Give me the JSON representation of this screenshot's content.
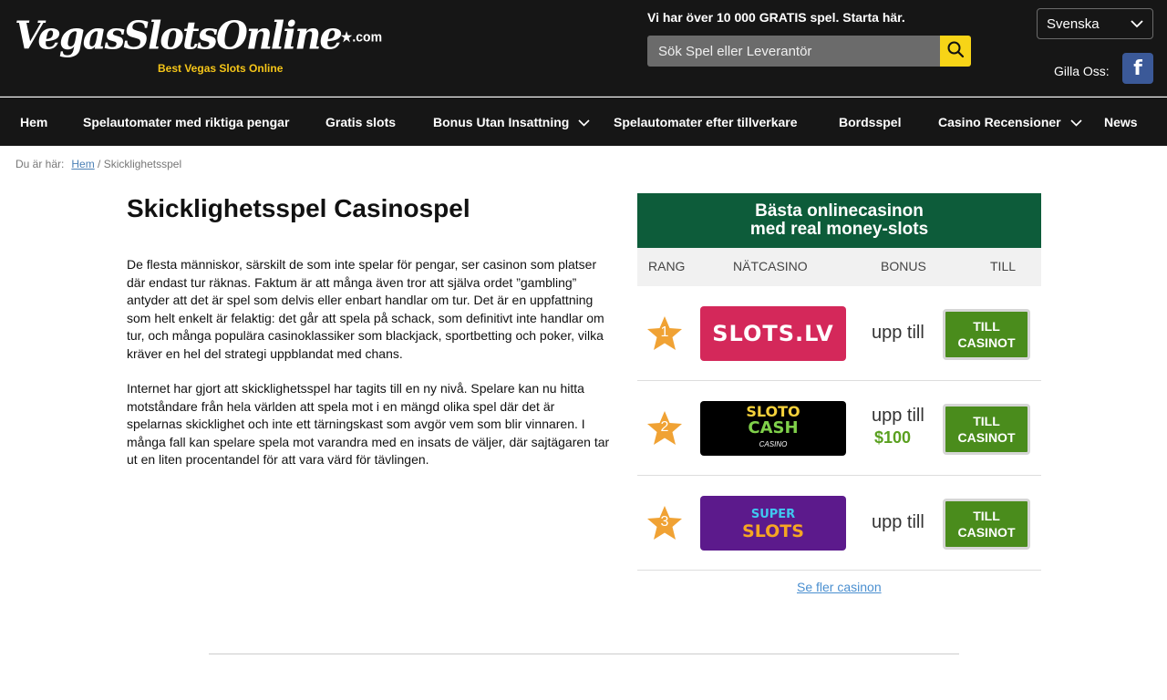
{
  "header": {
    "logo_main": "VegasSlotsOnline",
    "logo_com": "★.com",
    "logo_tagline": "Best Vegas Slots Online",
    "promo": "Vi har över 10 000 GRATIS spel. Starta här.",
    "search_placeholder": "Sök Spel eller Leverantör",
    "language": "Svenska",
    "like_label": "Gilla Oss:",
    "fb_letter": "f"
  },
  "nav": {
    "items": [
      {
        "label": "Hem"
      },
      {
        "label": "Spelautomater med riktiga pengar"
      },
      {
        "label": "Gratis slots"
      },
      {
        "label": "Bonus Utan Insattning"
      },
      {
        "label": "Spelautomater efter tillverkare"
      },
      {
        "label": "Bordsspel"
      },
      {
        "label": "Casino Recensioner"
      },
      {
        "label": "News"
      }
    ]
  },
  "breadcrumb": {
    "prefix": "Du är här:",
    "home": "Hem",
    "separator": "/",
    "current": "Skicklighetsspel"
  },
  "article": {
    "title": "Skicklighetsspel Casinospel",
    "paragraphs": [
      "De flesta människor, särskilt de som inte spelar för pengar, ser casinon som platser där endast tur räknas. Faktum är att många även tror att själva ordet ”gambling” antyder att det är spel som delvis eller enbart handlar om tur. Det är en uppfattning som helt enkelt är felaktig: det går att spela på schack, som definitivt inte handlar om tur, och många populära casinoklassiker som blackjack, sportbetting och poker, vilka kräver en hel del strategi uppblandat med chans.",
      "Internet har gjort att skicklighetsspel har tagits till en ny nivå. Spelare kan nu hitta motståndare från hela världen att spela mot i en mängd olika spel där det är spelarnas skicklighet och inte ett tärningskast som avgör vem som blir vinnaren. I många fall kan spelare spela mot varandra med en insats de väljer, där sajtägaren tar ut en liten procentandel för att vara värd för tävlingen."
    ]
  },
  "casino_panel": {
    "title_line1": "Bästa onlinecasinon",
    "title_line2": "med real money-slots",
    "columns": {
      "rank": "RANG",
      "casino": "NÄTCASINO",
      "bonus": "BONUS",
      "to": "TILL"
    },
    "rows": [
      {
        "rank": "1",
        "logo_text": "SLOTS.LV",
        "bonus_prefix": "upp till",
        "bonus_amount": "",
        "cta_line1": "TILL",
        "cta_line2": "CASINOT"
      },
      {
        "rank": "2",
        "logo_text_top": "SLOTO",
        "logo_text_mid": "CASH",
        "logo_text_bottom": "CASINO",
        "bonus_prefix": "upp till",
        "bonus_amount": "$100",
        "cta_line1": "TILL",
        "cta_line2": "CASINOT"
      },
      {
        "rank": "3",
        "logo_text_top": "SUPER",
        "logo_text_bottom": "SLOTS",
        "bonus_prefix": "upp till",
        "bonus_amount": "",
        "cta_line1": "TILL",
        "cta_line2": "CASINOT"
      }
    ],
    "more_link": "Se fler casinon"
  },
  "colors": {
    "header_bg": "#161616",
    "accent_yellow": "#f7d417",
    "panel_green": "#0d5c3a",
    "cta_green": "#4a8c1c",
    "bonus_green": "#5aa020",
    "star_orange": "#f0a234",
    "slotslv_bg": "#d4285a",
    "slotocash_bg": "#000000",
    "superslots_bg": "#5c1a8c"
  },
  "icons": [
    "search-icon",
    "chevron-down-icon",
    "facebook-icon",
    "star-icon"
  ]
}
